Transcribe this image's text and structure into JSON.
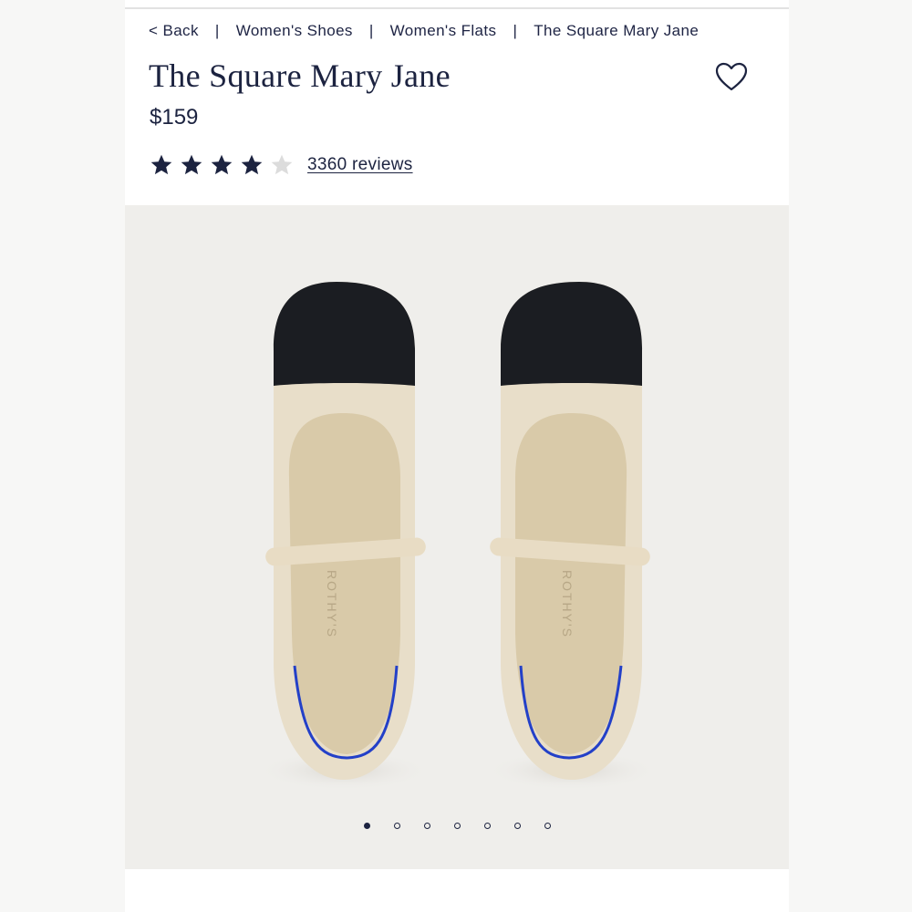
{
  "breadcrumb": {
    "back": "< Back",
    "separator": "|",
    "items": [
      "Women's Shoes",
      "Women's Flats",
      "The Square Mary Jane"
    ]
  },
  "product": {
    "title": "The Square Mary Jane",
    "price": "$159",
    "rating": 4,
    "rating_max": 5,
    "reviews_label": "3360 reviews",
    "favorite_icon": "heart-outline-icon"
  },
  "gallery": {
    "image_count": 7,
    "active_index": 0,
    "insole_brand": "ROTHY'S"
  },
  "colors": {
    "navy": "#1c2340",
    "star_empty": "#dcdcdc",
    "gallery_bg": "#efeeeb",
    "shoe_knit": "#e6dbc4",
    "toe_cap": "#1b1d22",
    "heel_accent": "#2340c8"
  }
}
